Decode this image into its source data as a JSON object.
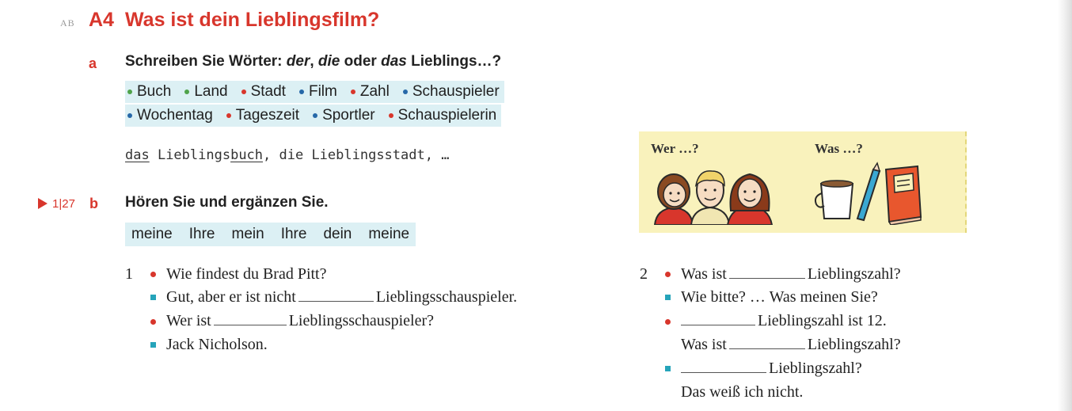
{
  "header": {
    "ab_label": "AB",
    "number": "A4",
    "title": "Was ist dein Lieblingsfilm?"
  },
  "part_a": {
    "letter": "a",
    "instruction": {
      "pre": "Schreiben Sie Wörter: ",
      "der": "der",
      "sep1": ", ",
      "die": "die",
      "sep2": " oder ",
      "das": "das",
      "post": " Lieblings…?"
    },
    "chips_row1": [
      {
        "text": "Buch",
        "color": "green"
      },
      {
        "text": "Land",
        "color": "green"
      },
      {
        "text": "Stadt",
        "color": "red"
      },
      {
        "text": "Film",
        "color": "blue"
      },
      {
        "text": "Zahl",
        "color": "red"
      },
      {
        "text": "Schauspieler",
        "color": "blue"
      }
    ],
    "chips_row2": [
      {
        "text": "Wochentag",
        "color": "blue"
      },
      {
        "text": "Tageszeit",
        "color": "red"
      },
      {
        "text": "Sportler",
        "color": "blue"
      },
      {
        "text": "Schauspielerin",
        "color": "red"
      }
    ],
    "example": {
      "w1": "das",
      "p1": " Lieblings",
      "w2": "buch",
      "p2": ", die Lieblingsstadt, …"
    }
  },
  "part_b": {
    "track": "1|27",
    "letter": "b",
    "instruction": "Hören Sie und ergänzen Sie.",
    "word_bank": [
      "meine",
      "Ihre",
      "mein",
      "Ihre",
      "dein",
      "meine"
    ]
  },
  "dialog1": {
    "number": "1",
    "lines": [
      {
        "pre": "Wie findest du Brad Pitt?",
        "post": ""
      },
      {
        "pre": "Gut, aber er ist nicht",
        "post": "Lieblingsschauspieler."
      },
      {
        "pre": "Wer ist",
        "post": "Lieblingsschauspieler?"
      },
      {
        "pre": "Jack Nicholson.",
        "post": ""
      }
    ]
  },
  "dialog2": {
    "number": "2",
    "lines": [
      {
        "pre": "Was ist",
        "post": "Lieblingszahl?"
      },
      {
        "pre": "Wie bitte? … Was meinen Sie?",
        "post": ""
      },
      {
        "pre": "",
        "post": "Lieblingszahl ist 12."
      },
      {
        "pre": "Was ist",
        "post": "Lieblingszahl?"
      },
      {
        "pre": "",
        "post": "Lieblingszahl?"
      },
      {
        "pre": "Das weiß ich nicht.",
        "post": ""
      }
    ]
  },
  "infobox": {
    "who": "Wer …?",
    "what": "Was …?"
  },
  "colors": {
    "accent_red": "#d8362c",
    "teal": "#26a4ba",
    "chip_bg": "#dcf0f4",
    "infobox_bg": "#f9f2bc",
    "dot_green": "#4fa34a",
    "dot_red": "#d8362c",
    "dot_blue": "#2668a8"
  }
}
